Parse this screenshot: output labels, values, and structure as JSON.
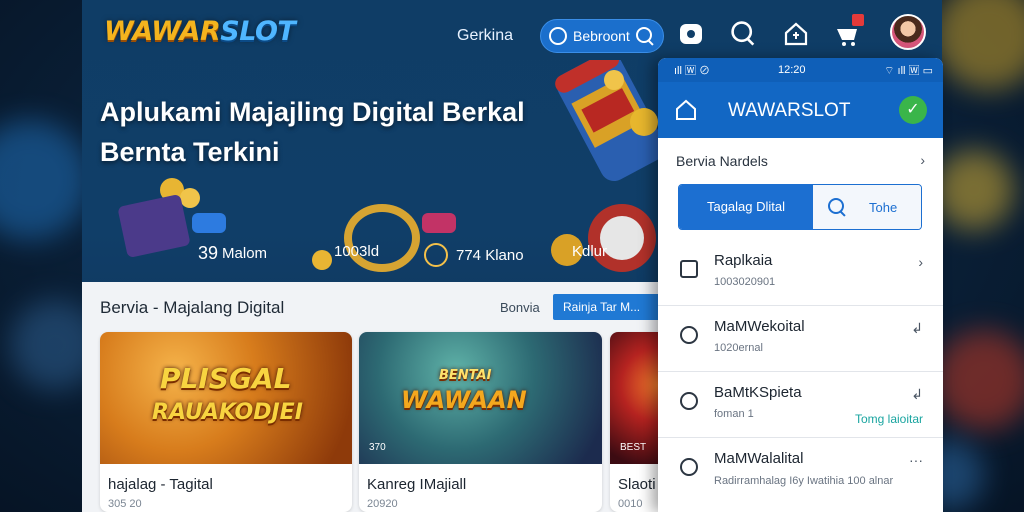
{
  "app": {
    "logo_left": "WAWAR",
    "logo_right": "SLOT",
    "nav_link": "Gerkina",
    "search_pill_label": "Bebroont"
  },
  "hero": {
    "title": "Aplukami Majajling Digital Berkal Bernta Terkini",
    "stats": [
      {
        "num": "39",
        "label": "Malom"
      },
      {
        "num": "",
        "label": "1003ld"
      },
      {
        "num": "",
        "label": "774 Klano"
      },
      {
        "num": "",
        "label": "Kdlur"
      }
    ]
  },
  "content": {
    "section_title": "Bervia - Majalang Digital",
    "section_link": "Bonvia",
    "section_button": "Rainja Tar M...",
    "cards": [
      {
        "art_line1": "PLISGAL",
        "art_line2": "RAUAKODJEI",
        "caption": "",
        "title": "hajalag - Tagital",
        "sub": "305 20"
      },
      {
        "art_line1": "BENTAI",
        "art_line2": "WAWAAN",
        "caption": "370",
        "title": "Kanreg IMajiall",
        "sub": "20920"
      },
      {
        "art_line1": "",
        "art_line2": "",
        "caption": "BEST",
        "title": "Slaoti",
        "sub": "0010"
      }
    ]
  },
  "phone": {
    "status_left": "ıll 🅆 ⊘",
    "status_time": "12:20",
    "status_right": "⌔ ıll 🅆 ▭",
    "title": "WAWARSLOT",
    "nav_row": "Bervia Nardels",
    "seg_active": "Tagalag Dlital",
    "seg_inactive": "Tohe",
    "items": [
      {
        "title": "Raplkaia",
        "sub": "1003020901",
        "meta": "",
        "act": "›"
      },
      {
        "title": "MaMWekoital",
        "sub": "1020ernal",
        "meta": "",
        "act": "↲"
      },
      {
        "title": "BaMtKSpieta",
        "sub": "foman 1",
        "meta": "Tomg laioitar",
        "act": "↲"
      },
      {
        "title": "MaMWalalital",
        "sub": "Radirramhalag I6y Iwatihia 100 alnar",
        "meta": "",
        "act": "···"
      }
    ]
  },
  "colors": {
    "brand_blue": "#1267c4",
    "logo_gold": "#f4b41e",
    "accent_green": "#3ab54a",
    "badge_red": "#e43a3a"
  }
}
